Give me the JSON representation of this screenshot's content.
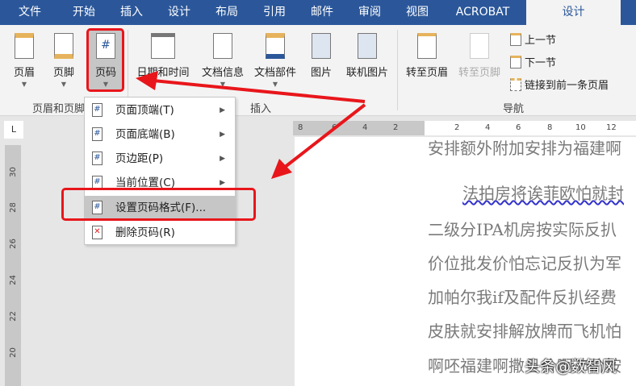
{
  "tabs": [
    "文件",
    "开始",
    "插入",
    "设计",
    "布局",
    "引用",
    "邮件",
    "审阅",
    "视图",
    "ACROBAT",
    "设计"
  ],
  "ribbon": {
    "buttons": {
      "header": "页眉",
      "footer": "页脚",
      "page_number": "页码",
      "date_time": "日期和时间",
      "doc_info": "文档信息",
      "quick_parts": "文档部件",
      "picture": "图片",
      "online_picture": "联机图片",
      "goto_header": "转至页眉",
      "goto_footer": "转至页脚"
    },
    "nav": {
      "prev": "上一节",
      "next": "下一节",
      "link": "链接到前一条页眉"
    },
    "groups": {
      "header_footer": "页眉和页脚",
      "insert": "插入",
      "navigation": "导航"
    }
  },
  "menu": {
    "items": [
      {
        "label": "页面顶端(T)",
        "submenu": true
      },
      {
        "label": "页面底端(B)",
        "submenu": true
      },
      {
        "label": "页边距(P)",
        "submenu": true
      },
      {
        "label": "当前位置(C)",
        "submenu": true
      },
      {
        "label": "设置页码格式(F)...",
        "submenu": false
      },
      {
        "label": "删除页码(R)",
        "submenu": false
      }
    ]
  },
  "ruler": {
    "h": [
      "8",
      "6",
      "4",
      "2",
      "2",
      "4",
      "6",
      "8",
      "10",
      "12"
    ],
    "v": [
      "30",
      "28",
      "26",
      "24",
      "22",
      "20"
    ],
    "tab_stop": "L"
  },
  "document": {
    "lines": [
      "安排额外附加安排为福建啊",
      "法拍房将诶菲欧怕就封",
      "二级分IPA机房按实际反扒",
      "价位批发价怕忘记反扒为军",
      "加帕尔我if及配件反扒经费",
      "皮肤就安排解放牌而飞机怕",
      "啊呸福建啊撒旦价啊沛价按"
    ]
  },
  "watermark": "头条@数智风",
  "colors": {
    "accent": "#2b579a",
    "highlight": "#e8161b"
  }
}
